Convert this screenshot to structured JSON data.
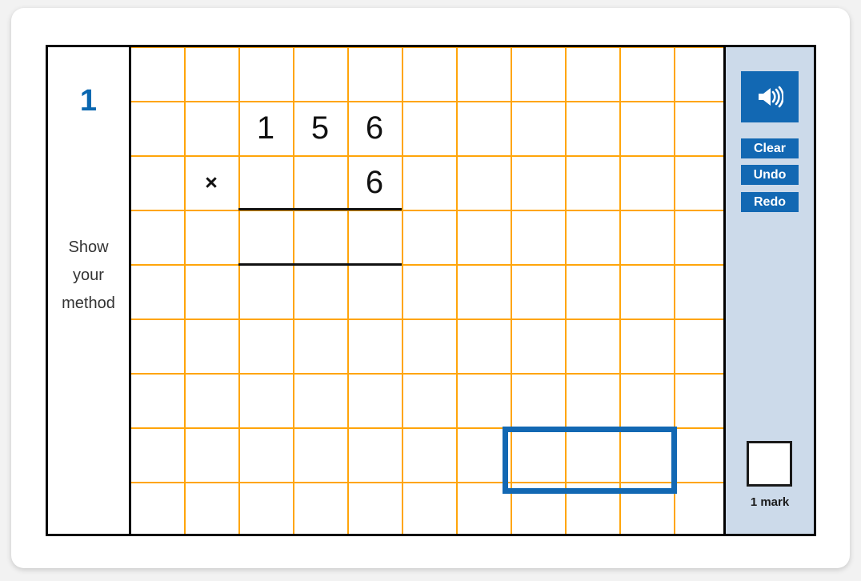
{
  "question": {
    "number": "1",
    "instruction_lines": [
      "Show",
      "your",
      "method"
    ]
  },
  "calculation": {
    "operator": "×",
    "top_number_digits": [
      "1",
      "5",
      "6"
    ],
    "bottom_number_digits": [
      "6"
    ],
    "top_number": "156",
    "bottom_number": "6",
    "expression": "156 × 6",
    "answer_value": ""
  },
  "toolbar": {
    "sound_icon": "speaker-icon",
    "clear_label": "Clear",
    "undo_label": "Undo",
    "redo_label": "Redo"
  },
  "marks": {
    "value": "",
    "label": "1 mark"
  },
  "colors": {
    "accent_blue": "#1268b3",
    "grid_orange": "#FFA50A",
    "sidebar_blue": "#ccdaea",
    "number_blue": "#0a67b0",
    "ink_black": "#111111"
  }
}
